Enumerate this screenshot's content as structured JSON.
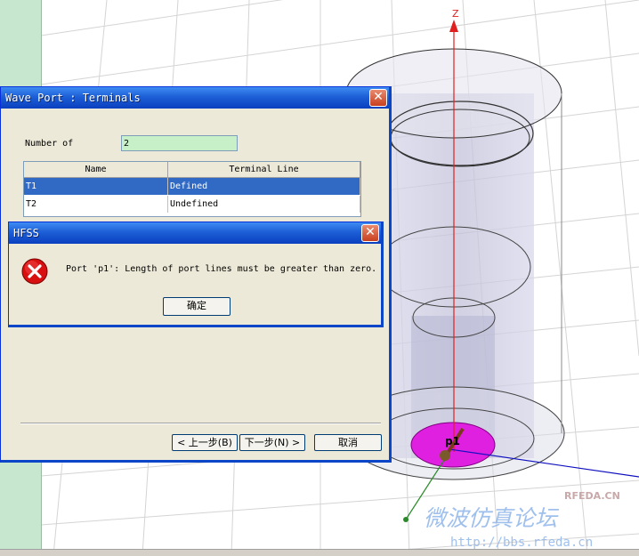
{
  "viewport": {
    "axis_z_label": "Z",
    "port_label": "p1",
    "watermark_cn": "微波仿真论坛",
    "watermark_url": "http://bbs.rfeda.cn",
    "watermark_brand": "RFEDA.CN"
  },
  "wave_port_dialog": {
    "title": "Wave Port : Terminals",
    "close_glyph": "✕",
    "number_of_label": "Number of",
    "number_of_value": "2",
    "table": {
      "columns": [
        "Name",
        "Terminal Line"
      ],
      "rows": [
        {
          "name": "T1",
          "terminal_line": "Defined",
          "selected": true
        },
        {
          "name": "T2",
          "terminal_line": "Undefined",
          "selected": false
        }
      ]
    },
    "buttons": {
      "back": "< 上一步(B)",
      "next": "下一步(N) >",
      "cancel": "取消"
    }
  },
  "error_dialog": {
    "title": "HFSS",
    "close_glyph": "✕",
    "message": "Port 'p1': Length of port lines must be greater than zero.",
    "ok_label": "确定"
  },
  "colors": {
    "port_fill": "#e020e0",
    "z_axis": "#e02020",
    "x_axis": "#1010c0",
    "y_axis": "#2a8a2a",
    "error_icon": "#d81010"
  }
}
